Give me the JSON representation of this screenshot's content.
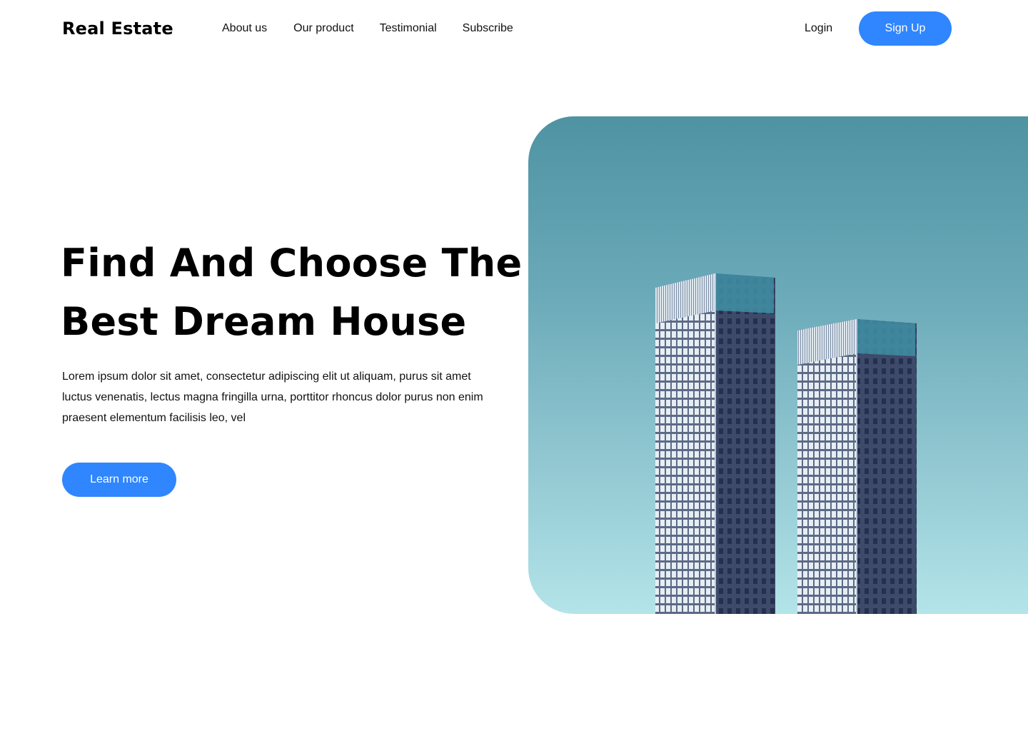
{
  "header": {
    "brand": "Real Estate",
    "nav": [
      "About us",
      "Our product",
      "Testimonial",
      "Subscribe"
    ],
    "login_label": "Login",
    "signup_label": "Sign Up"
  },
  "hero": {
    "title_line1": "Find And Choose The",
    "title_line2": "Best Dream House",
    "description": "Lorem ipsum dolor sit amet, consectetur adipiscing elit ut aliquam, purus sit amet luctus venenatis, lectus magna fringilla urna, porttitor rhoncus dolor purus non enim praesent elementum facilisis leo, vel",
    "cta_label": "Learn more",
    "image_alt": "towers-photo"
  },
  "colors": {
    "accent": "#2f86ff",
    "sky_top": "#4f93a3",
    "sky_bottom": "#b3e4e9"
  }
}
